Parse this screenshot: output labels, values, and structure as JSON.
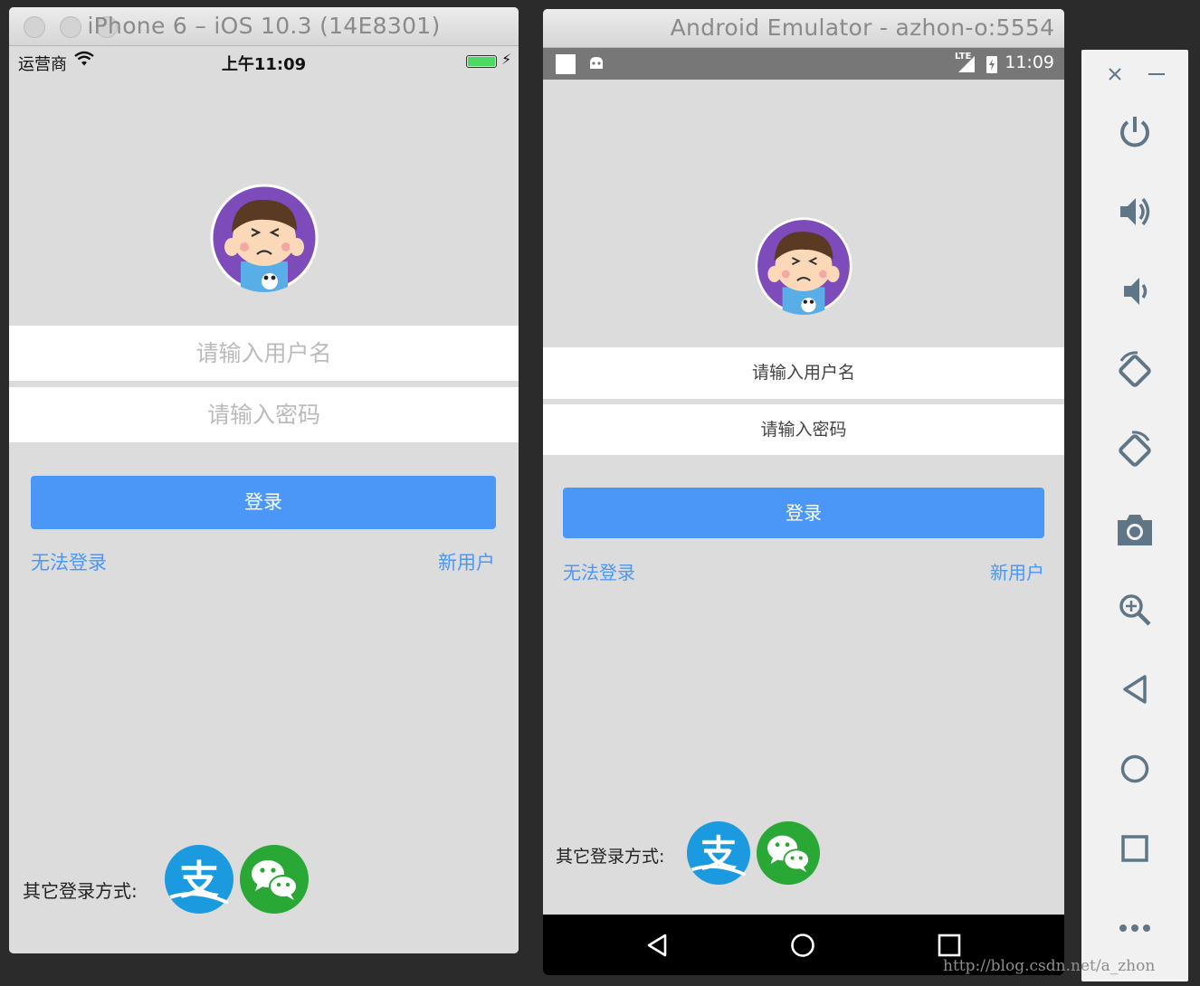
{
  "ios_window": {
    "title": "iPhone 6 – iOS 10.3 (14E8301)",
    "status": {
      "carrier": "运营商",
      "time": "上午11:09"
    },
    "login": {
      "username_placeholder": "请输入用户名",
      "password_placeholder": "请输入密码",
      "login_button": "登录",
      "cannot_login_link": "无法登录",
      "new_user_link": "新用户",
      "other_methods_label": "其它登录方式:"
    }
  },
  "android_window": {
    "title": "Android Emulator - azhon-o:5554",
    "status": {
      "time": "11:09",
      "network": "LTE"
    },
    "login": {
      "username_placeholder": "请输入用户名",
      "password_placeholder": "请输入密码",
      "login_button": "登录",
      "cannot_login_link": "无法登录",
      "new_user_link": "新用户",
      "other_methods_label": "其它登录方式:"
    }
  },
  "alipay_glyph": "支",
  "watermark": "http://blog.csdn.net/a_zhon",
  "colors": {
    "accent_blue": "#4a97f8",
    "screen_bg": "#dcdcdc",
    "alipay": "#1b9ae0",
    "wechat": "#2aa836"
  },
  "emulator_toolbar": {
    "icons": [
      "close-icon",
      "minimize-icon",
      "power-icon",
      "volume-up-icon",
      "volume-down-icon",
      "rotate-left-icon",
      "rotate-right-icon",
      "camera-icon",
      "zoom-icon",
      "back-icon",
      "home-icon",
      "overview-icon",
      "more-icon"
    ]
  }
}
